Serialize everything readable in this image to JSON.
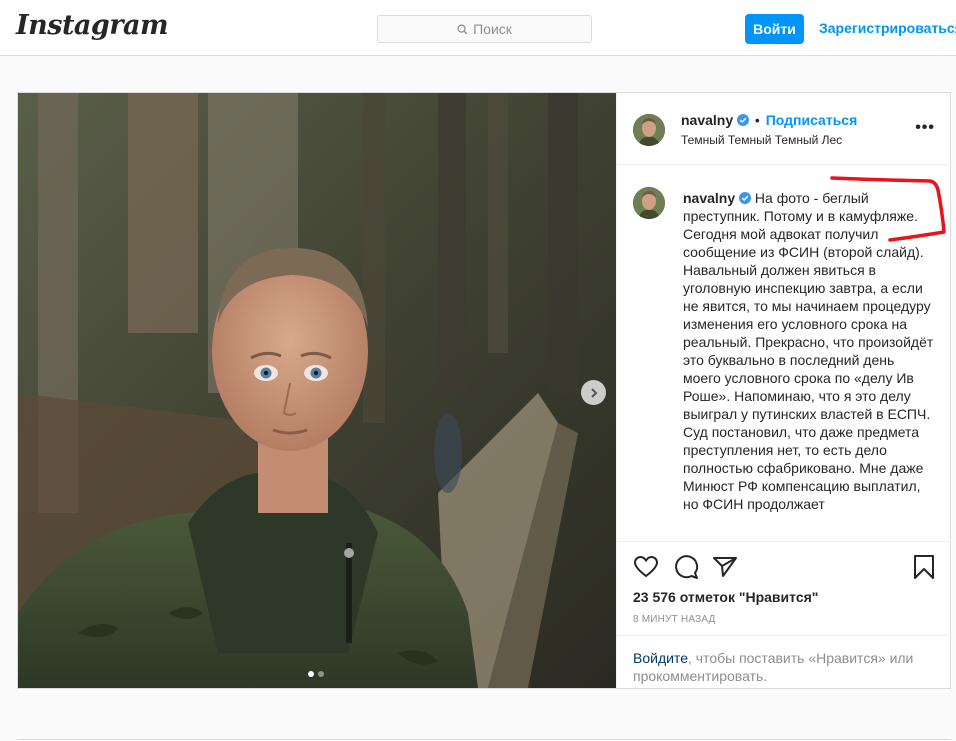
{
  "app": {
    "logo": "Instagram"
  },
  "search": {
    "placeholder": "Поиск",
    "icon": "search-icon"
  },
  "auth": {
    "login_label": "Войти",
    "register_label": "Зарегистрироваться"
  },
  "post": {
    "username": "navalny",
    "separator": "•",
    "follow_label": "Подписаться",
    "location": "Темный Темный Темный Лес",
    "more_label": "•••",
    "caption": "На фото - беглый преступник. Потому и в камуфляже. Сегодня мой адвокат получил сообщение из ФСИН (второй слайд). Навальный должен явиться в уголовную инспекцию завтра, а если не явится, то мы начинаем процедуру изменения его условного срока на реальный. Прекрасно, что произойдёт это буквально в последний день моего условного срока по «делу Ив Роше». Напоминаю, что я это делу выиграл у путинских властей в ЕСПЧ. Суд постановил, что даже предмета преступления нет, то есть дело полностью сфабриковано. Мне даже Минюст РФ компенсацию выплатил, но ФСИН продолжает",
    "likes": "23 576 отметок \"Нравится\"",
    "time": "8 МИНУТ НАЗАД",
    "login_prompt_link": "Войдите",
    "login_prompt_rest": ", чтобы поставить «Нравится» или прокомментировать.",
    "carousel": {
      "current": 1,
      "total": 2
    }
  },
  "colors": {
    "accent": "#0095f6",
    "verified": "#3897f0",
    "annotation": "#e8131b"
  }
}
